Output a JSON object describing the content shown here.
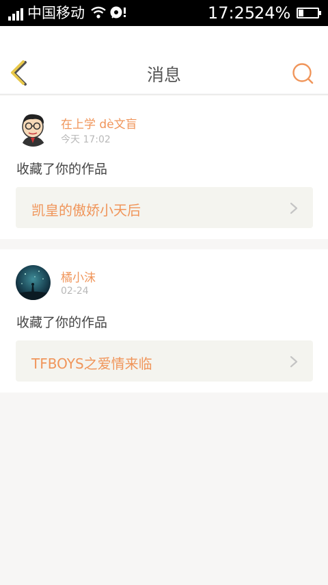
{
  "status_bar": {
    "carrier": "中国移动",
    "time": "17:25",
    "battery_pct": "24%",
    "battery_level": 0.24,
    "icons": [
      "signal-icon",
      "wifi-icon",
      "message-icon",
      "battery-icon"
    ]
  },
  "header": {
    "title": "消息",
    "back_icon": "chevron-left-icon",
    "search_icon": "search-icon"
  },
  "colors": {
    "accent": "#f0955a",
    "back_icon": "#e8c84a",
    "text": "#444444",
    "muted": "#b8b8b8",
    "work_bg": "#f4f4ef",
    "page_bg": "#f7f6f5"
  },
  "messages": [
    {
      "user": "在上学 dè文盲",
      "time": "今天 17:02",
      "action": "收藏了你的作品",
      "work_title": "凯皇的傲娇小天后"
    },
    {
      "user": "橘小沫",
      "time": "02-24",
      "action": "收藏了你的作品",
      "work_title": "TFBOYS之爱情来临"
    }
  ]
}
